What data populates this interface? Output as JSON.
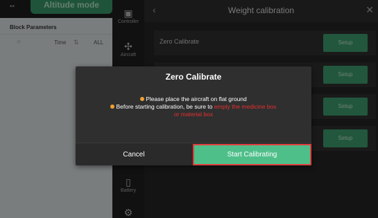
{
  "left_panel": {
    "mode_label": "Altitude mode",
    "title": "Block Parameters",
    "filter": {
      "time_label": "Time",
      "all_label": "ALL"
    }
  },
  "nav": [
    {
      "label": "Controller",
      "icon": "controller-icon"
    },
    {
      "label": "Aircraft",
      "icon": "aircraft-icon"
    },
    {
      "label": "Battery",
      "icon": "battery-icon"
    },
    {
      "label": "",
      "icon": "gear-icon"
    }
  ],
  "main": {
    "title": "Weight calibration",
    "rows": [
      {
        "label": "Zero Calibrate",
        "button": "Setup"
      },
      {
        "label": "",
        "button": "Setup"
      },
      {
        "label": "",
        "button": "Setup"
      },
      {
        "label": "",
        "button": "Setup"
      }
    ]
  },
  "dialog": {
    "title": "Zero Calibrate",
    "line1": "Please place the aircraft on flat ground",
    "line2_prefix": "Before starting calibration, be sure to ",
    "line2_red": "empty the medicine box",
    "line3_red": "or material box",
    "cancel_label": "Cancel",
    "confirm_label": "Start Calibrating"
  },
  "colors": {
    "accent_green": "#4fbf8a",
    "warning_red": "#e53030",
    "bullet_orange": "#f0a030"
  }
}
